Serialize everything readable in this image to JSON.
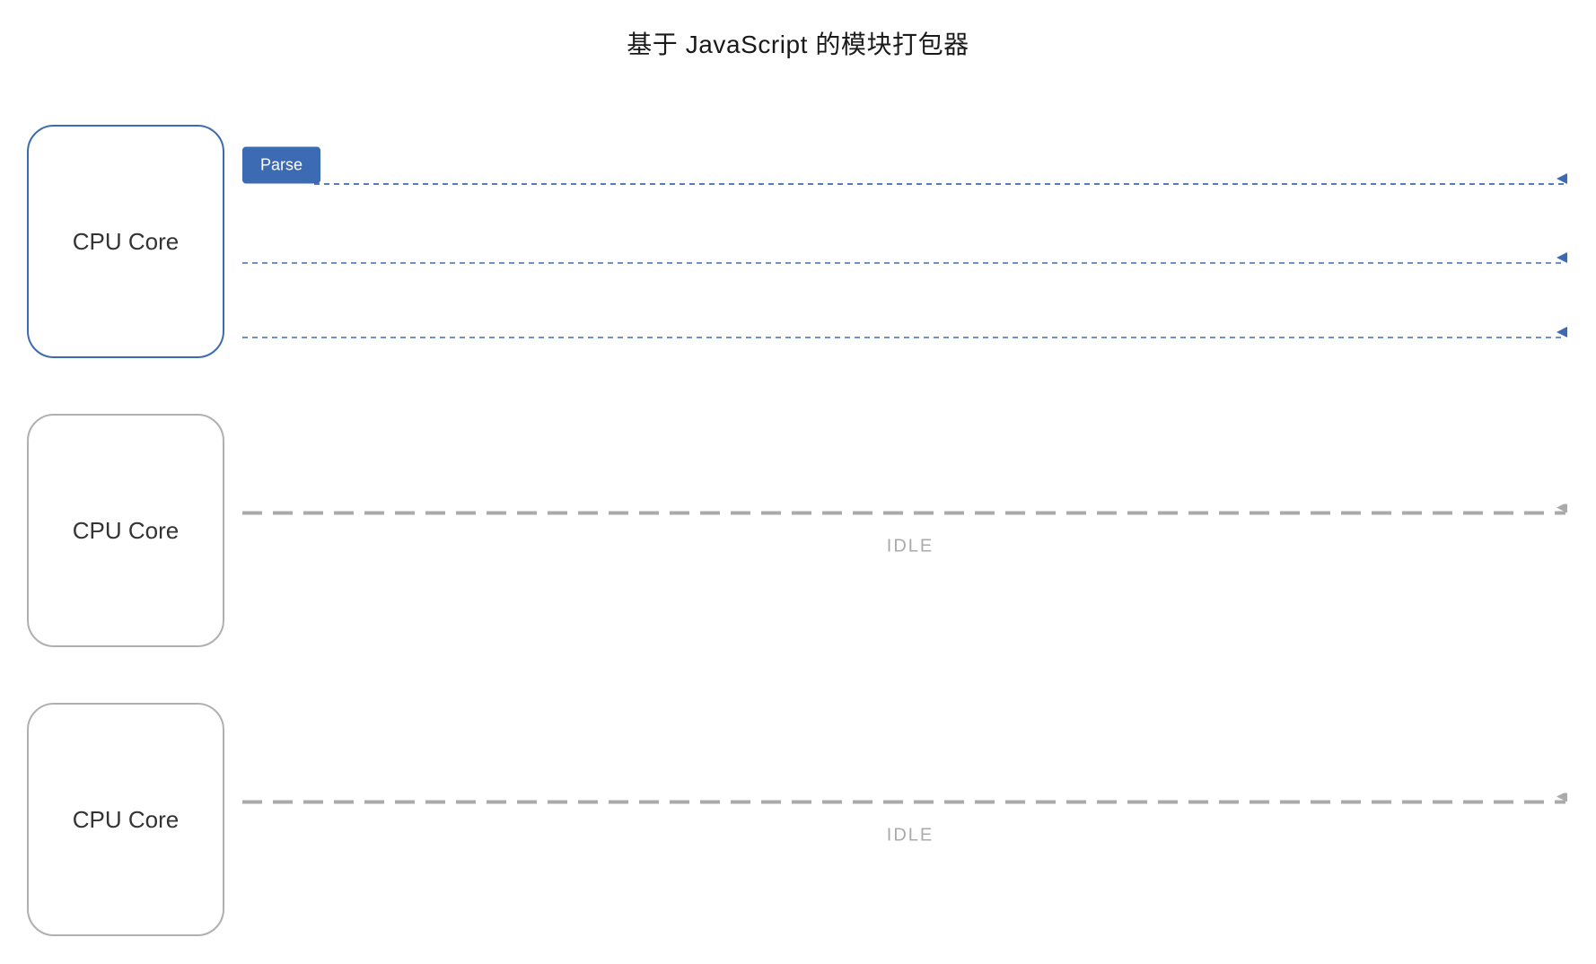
{
  "title": "基于 JavaScript 的模块打包器",
  "colors": {
    "active_border": "#3d6bb3",
    "idle_border": "#b0b0b0",
    "blue_line": "#3d6bb3",
    "gray_line": "#aaaaaa",
    "idle_label": "#aaaaaa",
    "parse_bg": "#3d6bb3",
    "parse_text_color": "#ffffff"
  },
  "cores": [
    {
      "id": "core1",
      "label": "CPU Core",
      "state": "active",
      "tasks": [
        {
          "label": "Parse",
          "type": "parse"
        }
      ],
      "lines": 3
    },
    {
      "id": "core2",
      "label": "CPU Core",
      "state": "idle",
      "idle_label": "IDLE"
    },
    {
      "id": "core3",
      "label": "CPU Core",
      "state": "idle",
      "idle_label": "IDLE"
    }
  ]
}
